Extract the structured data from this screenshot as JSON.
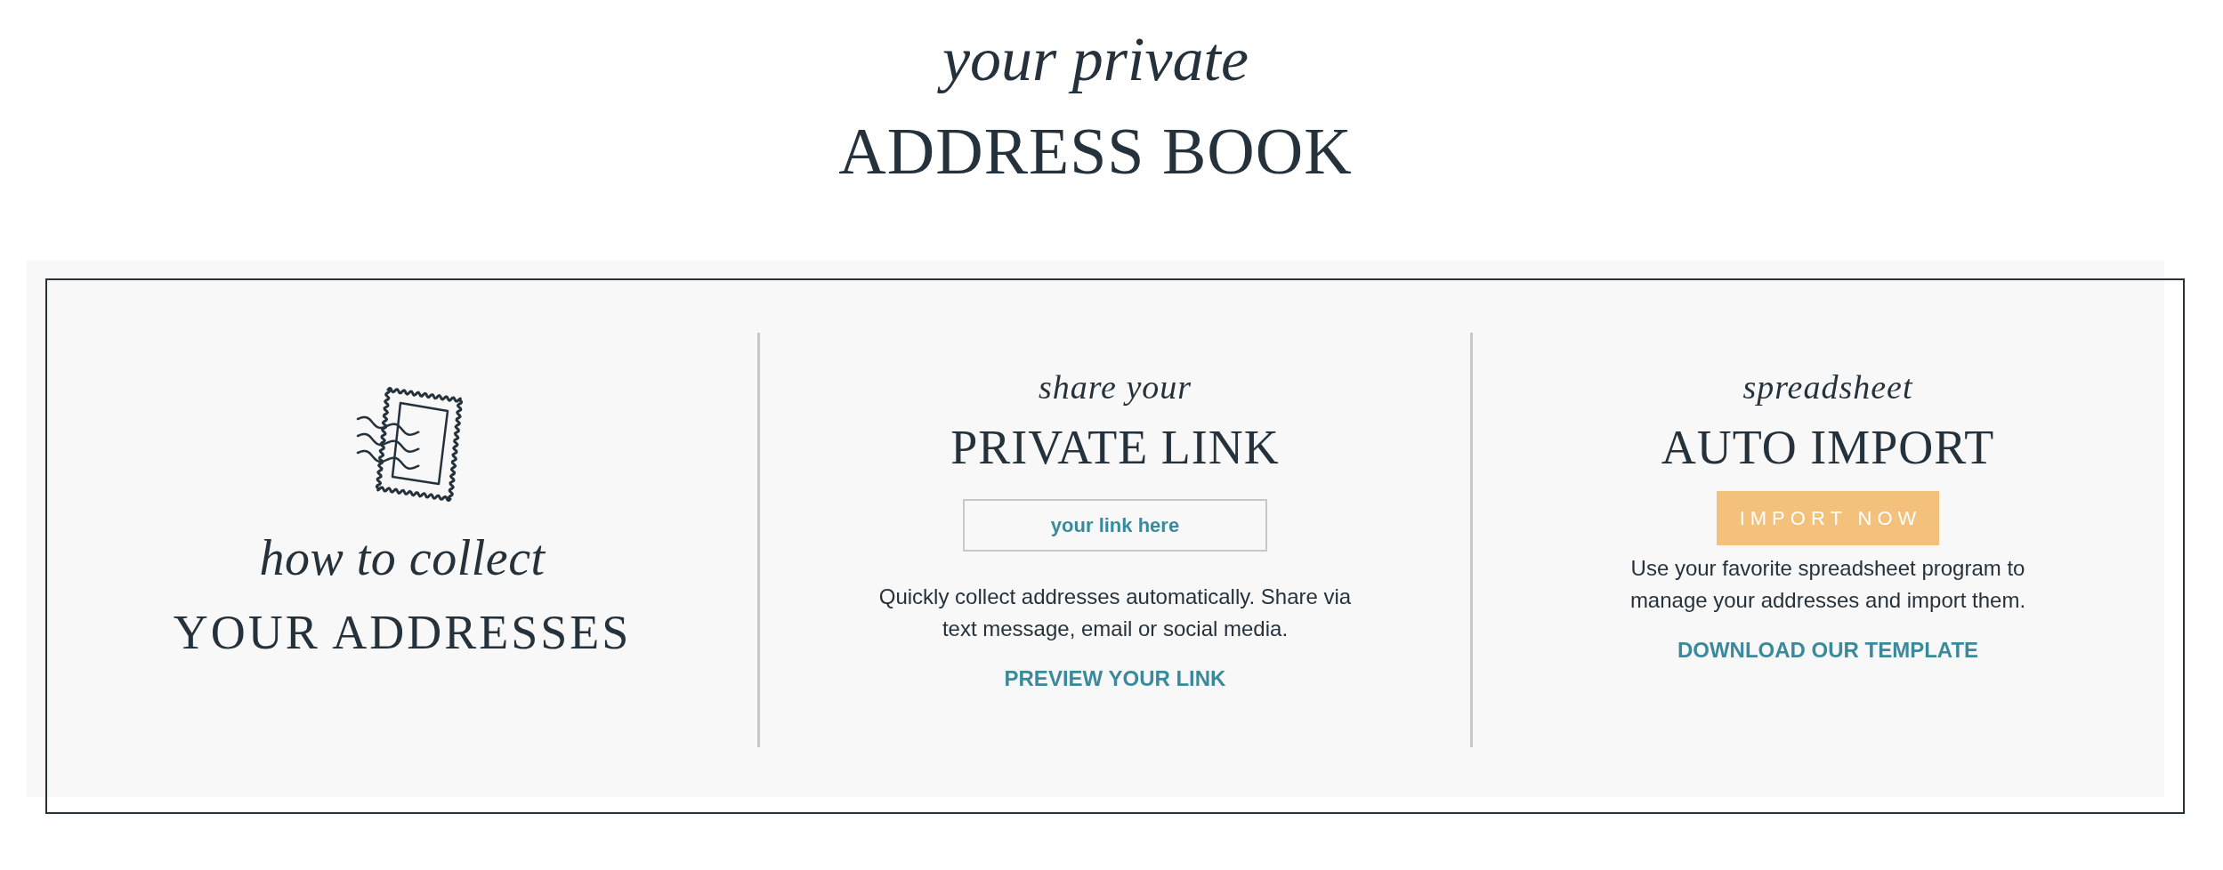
{
  "heading": {
    "subtitle": "your private",
    "title": "ADDRESS BOOK"
  },
  "sections": [
    {
      "kind": "intro",
      "subtitle": "how to collect",
      "title": "YOUR ADDRESSES"
    },
    {
      "kind": "link",
      "subtitle": "share your",
      "title": "PRIVATE LINK",
      "link_field": {
        "placeholder": "your link here"
      },
      "description": "Quickly collect addresses automatically. Share via text message, email or social media.",
      "link": "PREVIEW YOUR LINK"
    },
    {
      "kind": "import",
      "subtitle": "spreadsheet",
      "title": "AUTO IMPORT",
      "button": "IMPORT NOW",
      "description": "Use your favorite spreadsheet program to manage your addresses and import them.",
      "link": "DOWNLOAD OUR TEMPLATE"
    }
  ]
}
